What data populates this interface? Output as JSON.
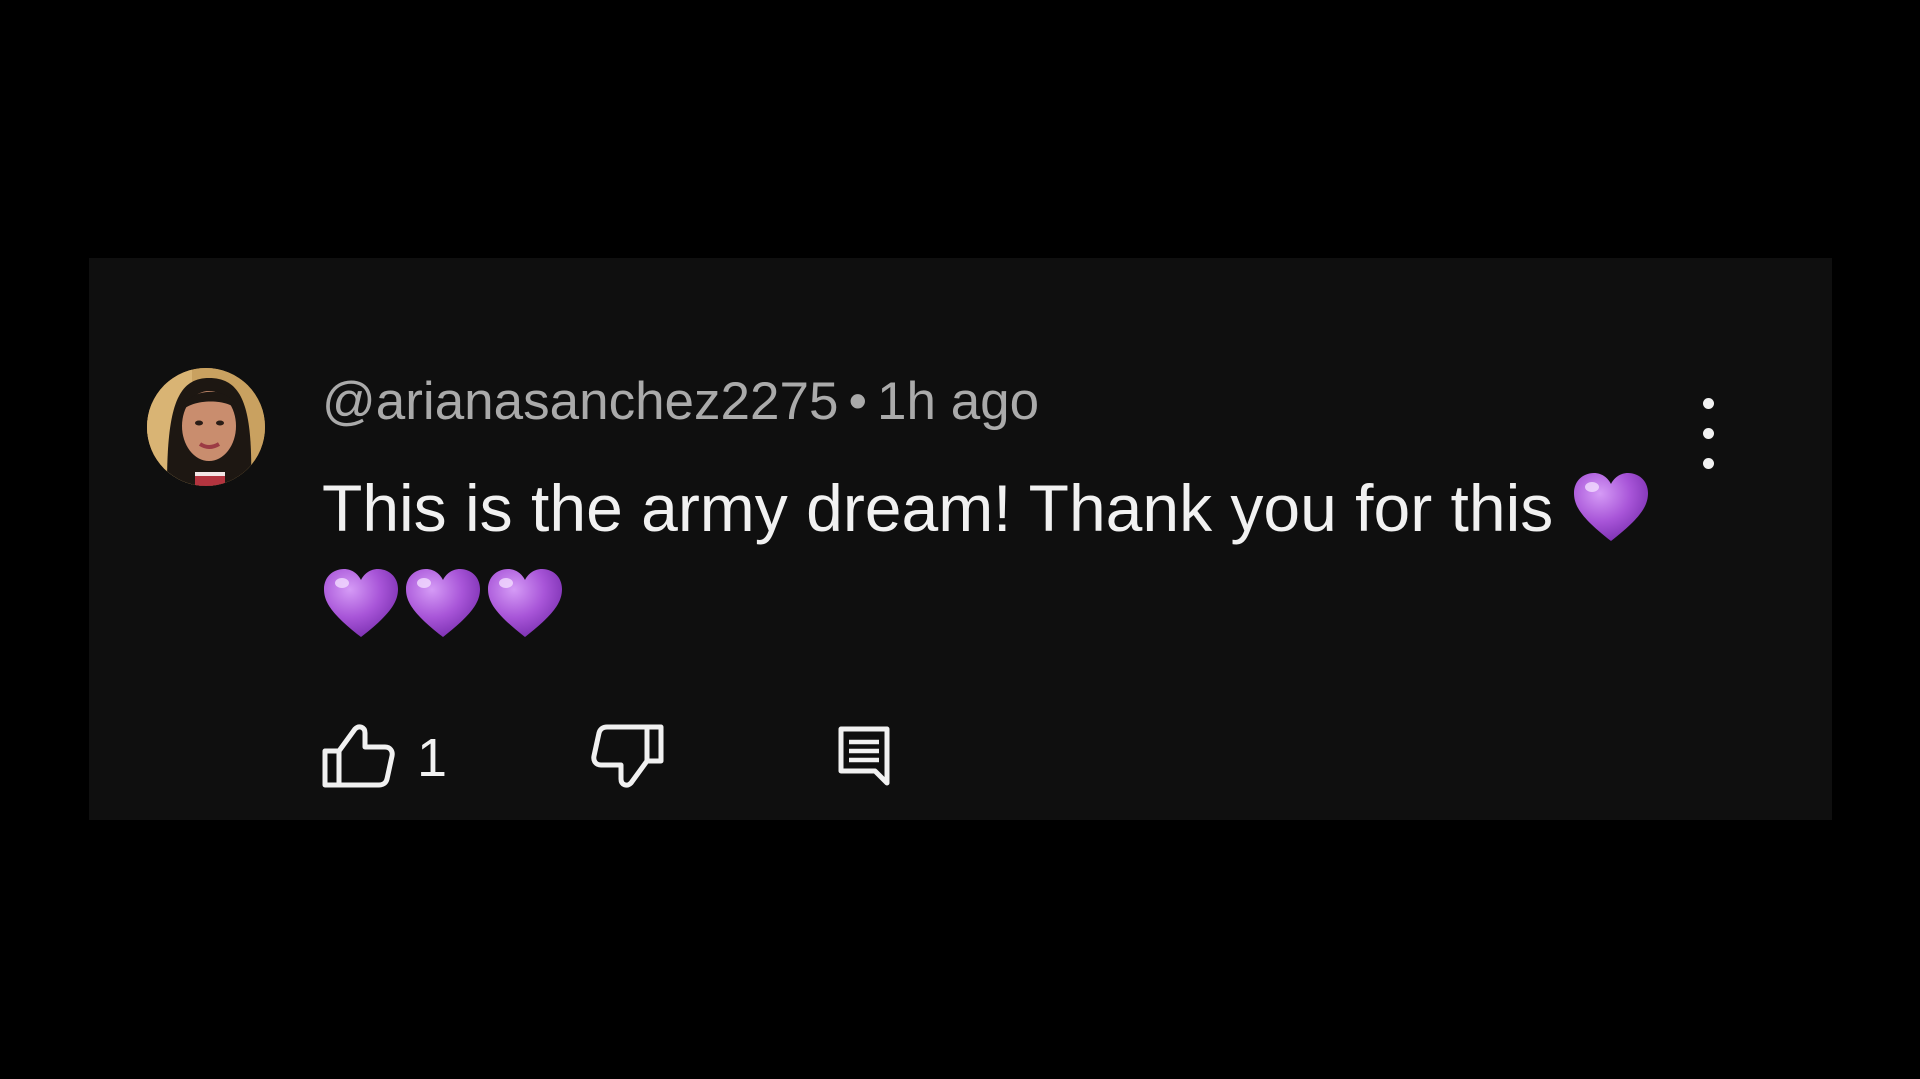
{
  "comment": {
    "author": "@arianasanchez2275",
    "separator": "•",
    "time": "1h ago",
    "text": "This is the army dream! Thank you for this",
    "emoji_count": 4,
    "emoji": "purple-heart-icon",
    "like_count": "1"
  },
  "icons": {
    "avatar": "avatar",
    "more": "more-vertical-icon",
    "like": "thumbs-up-icon",
    "dislike": "thumbs-down-icon",
    "reply": "reply-comment-icon"
  },
  "colors": {
    "background": "#000000",
    "card": "#0f0f0f",
    "meta_text": "#aaaaaa",
    "body_text": "#f1f1f1",
    "heart": "#a855d8"
  }
}
